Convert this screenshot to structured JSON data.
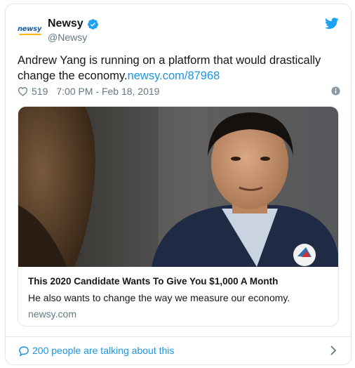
{
  "author": {
    "display_name": "Newsy",
    "handle": "@Newsy",
    "avatar_text": "newsy",
    "verified": true,
    "brand_color": "#1c5fa3"
  },
  "tweet": {
    "text": "Andrew Yang is running on a platform that would drastically change the economy.",
    "link_text": "newsy.com/87968",
    "like_count": "519",
    "timestamp": "7:00 PM - Feb 18, 2019"
  },
  "link_card": {
    "title": "This 2020 Candidate Wants To Give You $1,000 A Month",
    "description": "He also wants to change the way we measure our economy.",
    "domain": "newsy.com"
  },
  "footer": {
    "conversation_text": "200 people are talking about this"
  },
  "icons": {
    "verified": "verified-badge-icon",
    "twitter": "twitter-bird-icon",
    "heart": "heart-icon",
    "info": "info-icon",
    "comment": "comment-icon",
    "chevron": "chevron-right-icon"
  },
  "colors": {
    "accent": "#1b95e0",
    "twitter_blue": "#1da1f2",
    "secondary_text": "#657786",
    "border": "#e1e8ed"
  }
}
